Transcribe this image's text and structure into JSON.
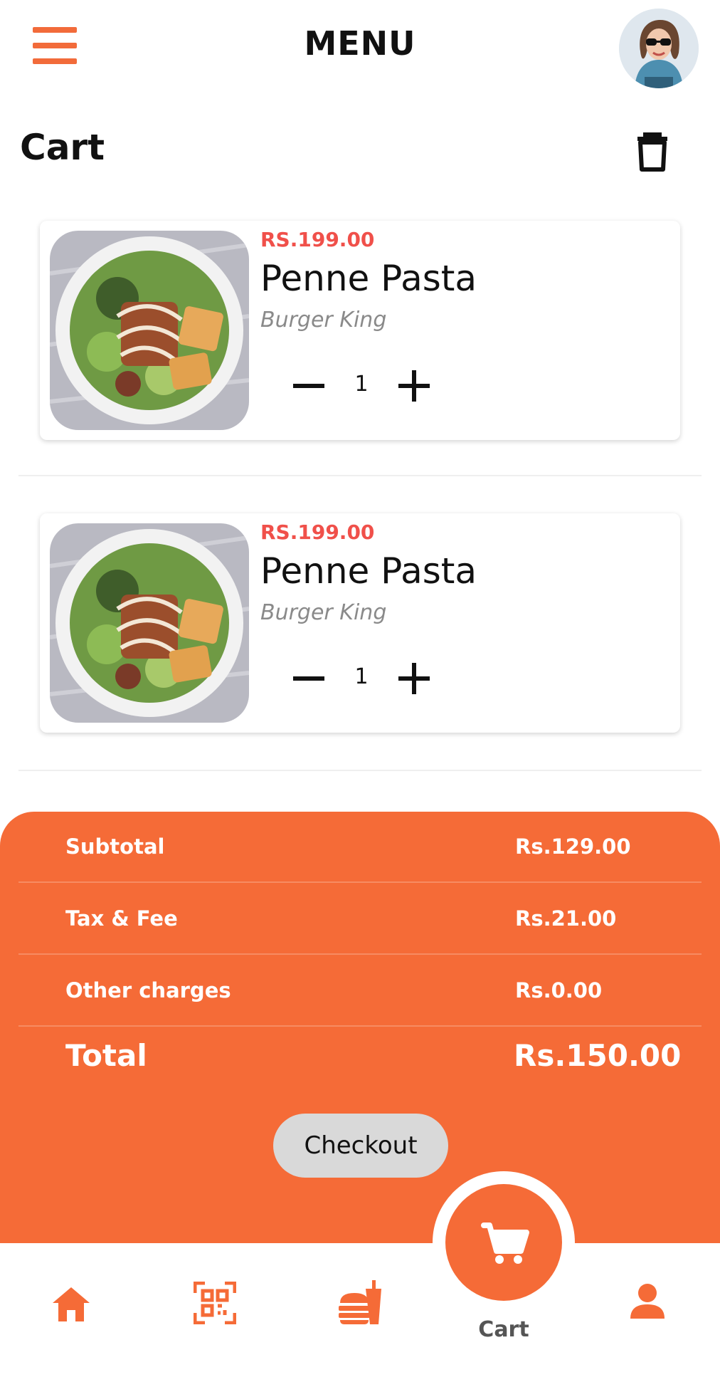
{
  "header": {
    "title": "MENU"
  },
  "cart": {
    "heading": "Cart"
  },
  "items": [
    {
      "price": "RS.199.00",
      "name": "Penne Pasta",
      "store": "Burger King",
      "quantity": "1"
    },
    {
      "price": "RS.199.00",
      "name": "Penne Pasta",
      "store": "Burger King",
      "quantity": "1"
    }
  ],
  "summary": {
    "rows": [
      {
        "label": "Subtotal",
        "value": "Rs.129.00"
      },
      {
        "label": "Tax & Fee",
        "value": "Rs.21.00"
      },
      {
        "label": "Other charges",
        "value": "Rs.0.00"
      }
    ],
    "total_label": "Total",
    "total_value": "Rs.150.00",
    "checkout_label": "Checkout"
  },
  "bottom_nav": {
    "items": [
      {
        "icon": "home-icon"
      },
      {
        "icon": "qr-scan-icon"
      },
      {
        "icon": "food-menu-icon"
      },
      {
        "icon": "cart-icon",
        "label": "Cart"
      },
      {
        "icon": "profile-icon"
      }
    ]
  },
  "colors": {
    "accent": "#f56b37",
    "price": "#f0504a",
    "button_gray": "#d9d9d9"
  }
}
